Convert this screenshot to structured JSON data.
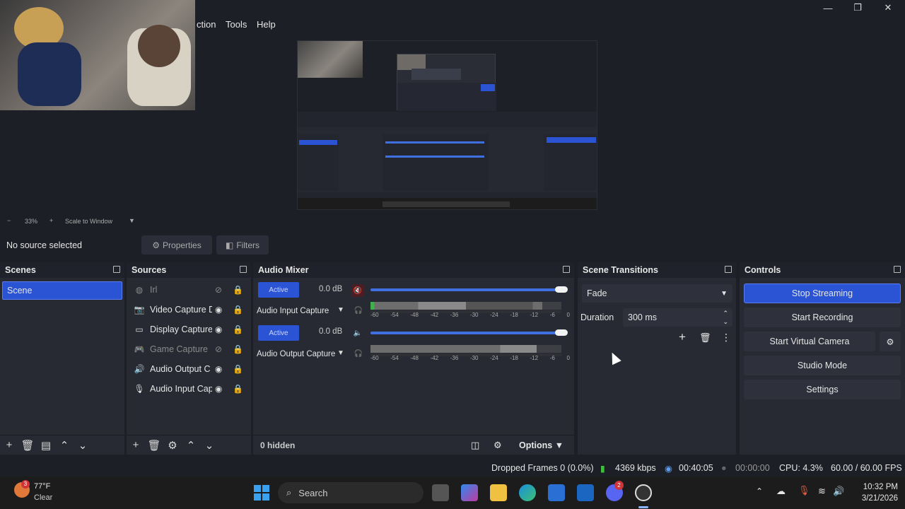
{
  "window": {
    "minimize_glyph": "—",
    "maximize_glyph": "❐",
    "close_glyph": "✕"
  },
  "menu": {
    "items": [
      "ction",
      "Tools",
      "Help"
    ]
  },
  "preview": {
    "zoom": "33%",
    "scale_mode": "Scale to Window"
  },
  "context": {
    "no_source": "No source selected",
    "properties_label": "Properties",
    "filters_label": "Filters"
  },
  "scenes": {
    "title": "Scenes",
    "items": [
      "Scene"
    ]
  },
  "sources": {
    "title": "Sources",
    "items": [
      {
        "label": "Irl",
        "icon": "globe-icon",
        "visible": false
      },
      {
        "label": "Video Capture D",
        "icon": "camera-icon",
        "visible": true
      },
      {
        "label": "Display Capture",
        "icon": "monitor-icon",
        "visible": true
      },
      {
        "label": "Game Capture",
        "icon": "gamepad-icon",
        "visible": false
      },
      {
        "label": "Audio Output C",
        "icon": "speaker-icon",
        "visible": true
      },
      {
        "label": "Audio Input Cap",
        "icon": "microphone-icon",
        "visible": true
      }
    ]
  },
  "mixer": {
    "title": "Audio Mixer",
    "channels": [
      {
        "status": "Active",
        "db": "0.0 dB",
        "name": "Audio Input Capture",
        "volume": 1.0,
        "muted": true
      },
      {
        "status": "Active",
        "db": "0.0 dB",
        "name": "Audio Output Capture",
        "volume": 1.0,
        "muted": false
      }
    ],
    "scale": [
      "-60",
      "-54",
      "-48",
      "-42",
      "-36",
      "-30",
      "-24",
      "-18",
      "-12",
      "-6",
      "0"
    ],
    "hidden": "0 hidden",
    "options_label": "Options"
  },
  "transitions": {
    "title": "Scene Transitions",
    "selected": "Fade",
    "duration_label": "Duration",
    "duration_value": "300 ms"
  },
  "controls": {
    "title": "Controls",
    "stop_streaming": "Stop Streaming",
    "start_recording": "Start Recording",
    "start_virtual_camera": "Start Virtual Camera",
    "studio_mode": "Studio Mode",
    "settings": "Settings"
  },
  "status": {
    "dropped_frames": "Dropped Frames 0 (0.0%)",
    "bitrate": "4369 kbps",
    "stream_time": "00:40:05",
    "record_time": "00:00:00",
    "cpu": "CPU: 4.3%",
    "fps": "60.00 / 60.00 FPS"
  },
  "taskbar": {
    "weather_temp": "77°F",
    "weather_cond": "Clear",
    "weather_badge": "3",
    "search_label": "Search",
    "discord_badge": "2",
    "time": "10:32 PM",
    "date": "3/21/2026"
  },
  "colors": {
    "accent": "#2a54d4",
    "mute_red": "#c0282a",
    "bitrate_green": "#3fbf3f"
  }
}
